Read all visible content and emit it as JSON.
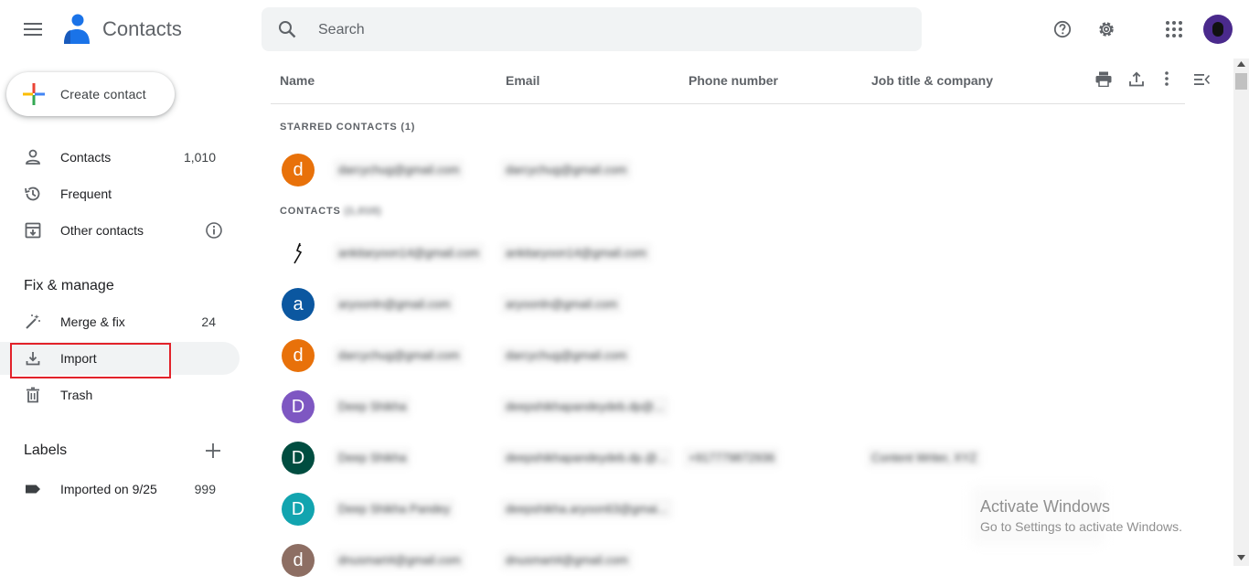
{
  "header": {
    "app_title": "Contacts",
    "search_placeholder": "Search",
    "icons": [
      "menu-icon",
      "contacts-logo",
      "search-icon",
      "help-icon",
      "settings-icon",
      "apps-icon",
      "account-avatar"
    ]
  },
  "sidebar": {
    "create_label": "Create contact",
    "items": [
      {
        "label": "Contacts",
        "count": "1,010",
        "icon": "person-icon"
      },
      {
        "label": "Frequent",
        "count": "",
        "icon": "history-icon"
      },
      {
        "label": "Other contacts",
        "count": "",
        "icon": "archive-icon"
      }
    ],
    "fix_manage_title": "Fix & manage",
    "fix_items": [
      {
        "label": "Merge & fix",
        "count": "24",
        "icon": "magic-wand-icon"
      },
      {
        "label": "Import",
        "count": "",
        "icon": "download-icon"
      },
      {
        "label": "Trash",
        "count": "",
        "icon": "trash-icon"
      }
    ],
    "labels_title": "Labels",
    "labels": [
      {
        "label": "Imported on 9/25",
        "count": "999",
        "icon": "label-icon"
      }
    ]
  },
  "table": {
    "columns": [
      "Name",
      "Email",
      "Phone number",
      "Job title & company"
    ],
    "starred_header": "STARRED CONTACTS (1)",
    "contacts_header": "CONTACTS",
    "contacts_header_count": "(1,010)",
    "rows": [
      {
        "initial": "d",
        "color": "#e8710a",
        "name": "darcychug@gmail.com",
        "email": "darcychug@gmail.com",
        "phone": "",
        "job": ""
      },
      {
        "initial": "",
        "color": "#ffffff",
        "name": "ankitaryoon14@gmail.com",
        "email": "ankitaryoon14@gmail.com",
        "phone": "",
        "job": ""
      },
      {
        "initial": "a",
        "color": "#0b57a0",
        "name": "aryoonln@gmail.com",
        "email": "aryoonln@gmail.com",
        "phone": "",
        "job": ""
      },
      {
        "initial": "d",
        "color": "#e8710a",
        "name": "darcychug@gmail.com",
        "email": "darcychug@gmail.com",
        "phone": "",
        "job": ""
      },
      {
        "initial": "D",
        "color": "#7e57c2",
        "name": "Deep Shikha",
        "email": "deepshikhapandeydeb.dp@...",
        "phone": "",
        "job": ""
      },
      {
        "initial": "D",
        "color": "#004d40",
        "name": "Deep Shikha",
        "email": "deepshikhapandeydeb.dp.@...",
        "phone": "+917779872936",
        "job": "Content Writer, XYZ"
      },
      {
        "initial": "D",
        "color": "#12a4af",
        "name": "Deep Shikha Pandey",
        "email": "deepshikha.aryoon63@gmai...",
        "phone": "",
        "job": ""
      },
      {
        "initial": "d",
        "color": "#8d6e63",
        "name": "dnusmart4@gmail.com",
        "email": "dnusmart4@gmail.com",
        "phone": "",
        "job": ""
      }
    ]
  },
  "watermark": {
    "line1": "Activate Windows",
    "line2": "Go to Settings to activate Windows."
  }
}
